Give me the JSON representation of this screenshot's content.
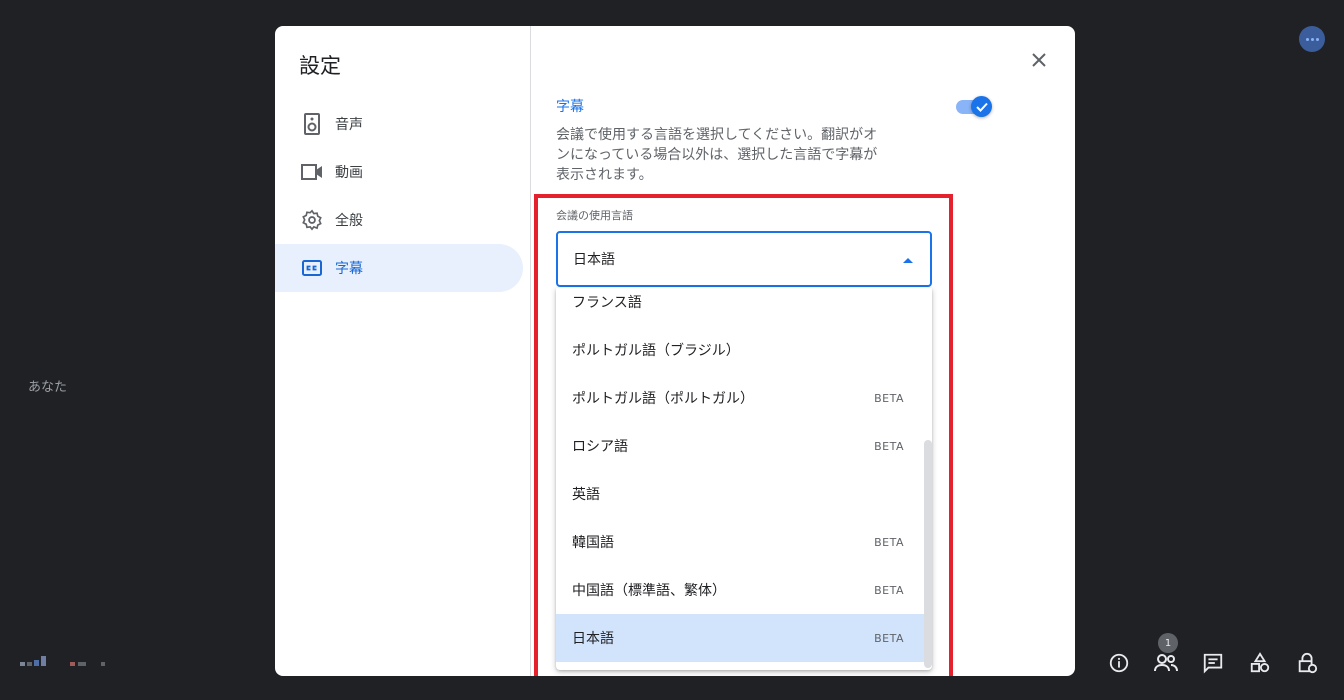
{
  "background": {
    "you_label": "あなた"
  },
  "dialog": {
    "title": "設定",
    "close_icon": "close-icon",
    "nav": [
      {
        "key": "audio",
        "label": "音声",
        "icon": "speaker-icon",
        "active": false
      },
      {
        "key": "video",
        "label": "動画",
        "icon": "videocam-icon",
        "active": false
      },
      {
        "key": "general",
        "label": "全般",
        "icon": "gear-icon",
        "active": false
      },
      {
        "key": "captions",
        "label": "字幕",
        "icon": "closed-caption-icon",
        "active": true
      }
    ],
    "captions": {
      "title": "字幕",
      "toggle_on": true,
      "description": "会議で使用する言語を選択してください。翻訳がオンになっている場合以外は、選択した言語で字幕が表示されます。",
      "field_label": "会議の使用言語",
      "selected_value": "日本語",
      "options": [
        {
          "label": "フランス語",
          "badge": ""
        },
        {
          "label": "ポルトガル語（ブラジル）",
          "badge": ""
        },
        {
          "label": "ポルトガル語（ポルトガル）",
          "badge": "BETA"
        },
        {
          "label": "ロシア語",
          "badge": "BETA"
        },
        {
          "label": "英語",
          "badge": ""
        },
        {
          "label": "韓国語",
          "badge": "BETA"
        },
        {
          "label": "中国語（標準語、繁体）",
          "badge": "BETA"
        },
        {
          "label": "日本語",
          "badge": "BETA",
          "selected": true
        }
      ]
    }
  },
  "toolbar": {
    "participants_count": "1",
    "icons": [
      "info-icon",
      "people-icon",
      "chat-icon",
      "activities-icon",
      "host-controls-icon"
    ]
  },
  "colors": {
    "accent": "#1a73e8",
    "highlight_box": "#e4212d",
    "selected_option_bg": "#d2e3fc",
    "page_bg": "#202124"
  }
}
